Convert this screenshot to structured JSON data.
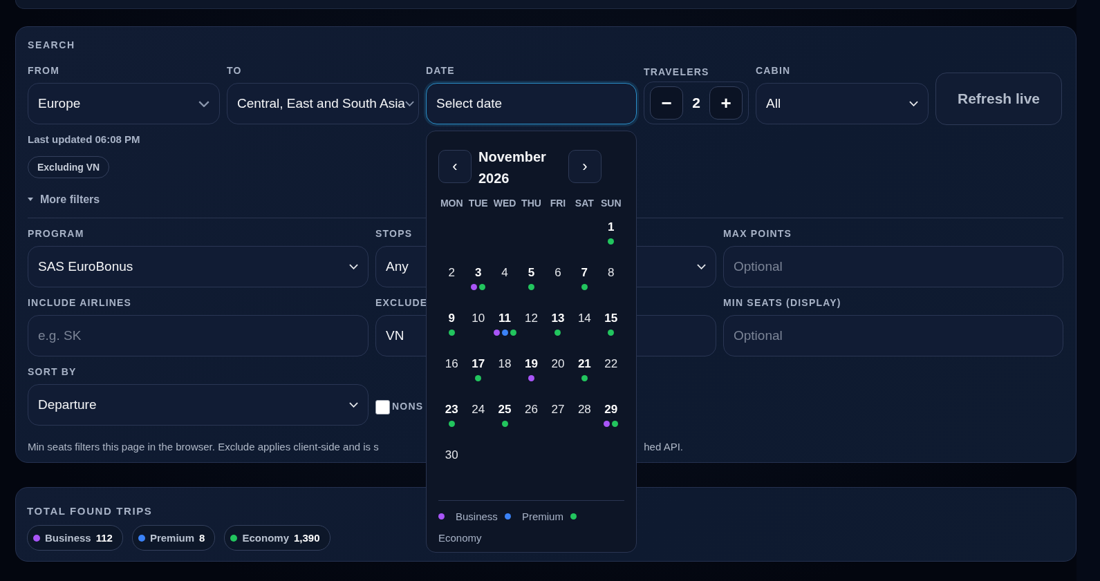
{
  "search": {
    "title": "SEARCH",
    "from": {
      "label": "FROM",
      "value": "Europe"
    },
    "to": {
      "label": "TO",
      "value": "Central, East and South Asia"
    },
    "date": {
      "label": "DATE",
      "value": "Select date",
      "focused": true
    },
    "travelers": {
      "label": "TRAVELERS",
      "minus": "−",
      "count": "2",
      "plus": "+"
    },
    "cabin": {
      "label": "CABIN",
      "value": "All"
    },
    "refresh_button": "Refresh live",
    "last_updated": "Last updated 06:08 PM",
    "filter_chips": [
      "Excluding VN"
    ],
    "more_filters": {
      "label": "More filters",
      "expanded": true
    },
    "program": {
      "label": "PROGRAM",
      "value": "SAS EuroBonus"
    },
    "stops": {
      "label": "STOPS",
      "value": "Any"
    },
    "max_points": {
      "label": "MAX POINTS",
      "placeholder": "Optional"
    },
    "include_airlines": {
      "label": "INCLUDE AIRLINES",
      "placeholder": "e.g. SK"
    },
    "exclude_airlines": {
      "label": "EXCLUDE",
      "value": "VN"
    },
    "min_seats": {
      "label": "MIN SEATS (DISPLAY)",
      "placeholder": "Optional"
    },
    "sort_by": {
      "label": "SORT BY",
      "value": "Departure"
    },
    "nonstop_only": {
      "label": "NONS",
      "checked": false
    },
    "note": [
      "Min seats filters this page in the browser. Exclude applies client-side and is s",
      "hed API."
    ]
  },
  "calendar": {
    "prev": "‹",
    "title": "November 2026",
    "next": "›",
    "weekdays": [
      "MON",
      "TUE",
      "WED",
      "THU",
      "FRI",
      "SAT",
      "SUN"
    ],
    "weeks": [
      [
        {
          "day": "1",
          "available": true,
          "dots": [
            {
              "color": "#22c55e"
            }
          ]
        }
      ],
      [
        {
          "day": "2",
          "available": false
        },
        {
          "day": "3",
          "available": true,
          "dots": [
            {
              "color": "#a855f7"
            },
            {
              "color": "#22c55e"
            }
          ]
        },
        {
          "day": "4",
          "available": false
        },
        {
          "day": "5",
          "available": true,
          "dots": [
            {
              "color": "#22c55e"
            }
          ]
        },
        {
          "day": "6",
          "available": false
        },
        {
          "day": "7",
          "available": true,
          "dots": [
            {
              "color": "#22c55e"
            }
          ]
        },
        {
          "day": "8",
          "available": false
        }
      ],
      [
        {
          "day": "9",
          "available": true,
          "dots": [
            {
              "color": "#22c55e"
            }
          ]
        },
        {
          "day": "10",
          "available": false
        },
        {
          "day": "11",
          "available": true,
          "dots": [
            {
              "color": "#a855f7"
            },
            {
              "color": "#3b82f6"
            },
            {
              "color": "#22c55e"
            }
          ]
        },
        {
          "day": "12",
          "available": false
        },
        {
          "day": "13",
          "available": true,
          "dots": [
            {
              "color": "#22c55e"
            }
          ]
        },
        {
          "day": "14",
          "available": false
        },
        {
          "day": "15",
          "available": true,
          "dots": [
            {
              "color": "#22c55e"
            }
          ]
        }
      ],
      [
        {
          "day": "16",
          "available": false
        },
        {
          "day": "17",
          "available": true,
          "dots": [
            {
              "color": "#22c55e"
            }
          ]
        },
        {
          "day": "18",
          "available": false
        },
        {
          "day": "19",
          "available": true,
          "dots": [
            {
              "color": "#a855f7"
            }
          ]
        },
        {
          "day": "20",
          "available": false
        },
        {
          "day": "21",
          "available": true,
          "dots": [
            {
              "color": "#22c55e"
            }
          ]
        },
        {
          "day": "22",
          "available": false
        }
      ],
      [
        {
          "day": "23",
          "available": true,
          "dots": [
            {
              "color": "#22c55e"
            }
          ]
        },
        {
          "day": "24",
          "available": false
        },
        {
          "day": "25",
          "available": true,
          "dots": [
            {
              "color": "#22c55e"
            }
          ]
        },
        {
          "day": "26",
          "available": false
        },
        {
          "day": "27",
          "available": false
        },
        {
          "day": "28",
          "available": false
        },
        {
          "day": "29",
          "available": true,
          "dots": [
            {
              "color": "#a855f7"
            },
            {
              "color": "#22c55e"
            }
          ]
        }
      ],
      [
        {
          "day": "30",
          "available": false
        }
      ]
    ],
    "legend": [
      {
        "label": "Business",
        "color": "#a855f7"
      },
      {
        "label": "Premium",
        "color": "#3b82f6"
      },
      {
        "label": "Economy",
        "color": "#22c55e"
      }
    ]
  },
  "totals": {
    "title": "TOTAL FOUND TRIPS",
    "items": [
      {
        "label": "Business",
        "count": "112",
        "color": "#a855f7"
      },
      {
        "label": "Premium",
        "count": "8",
        "color": "#3b82f6"
      },
      {
        "label": "Economy",
        "count": "1,390",
        "color": "#22c55e"
      }
    ]
  }
}
